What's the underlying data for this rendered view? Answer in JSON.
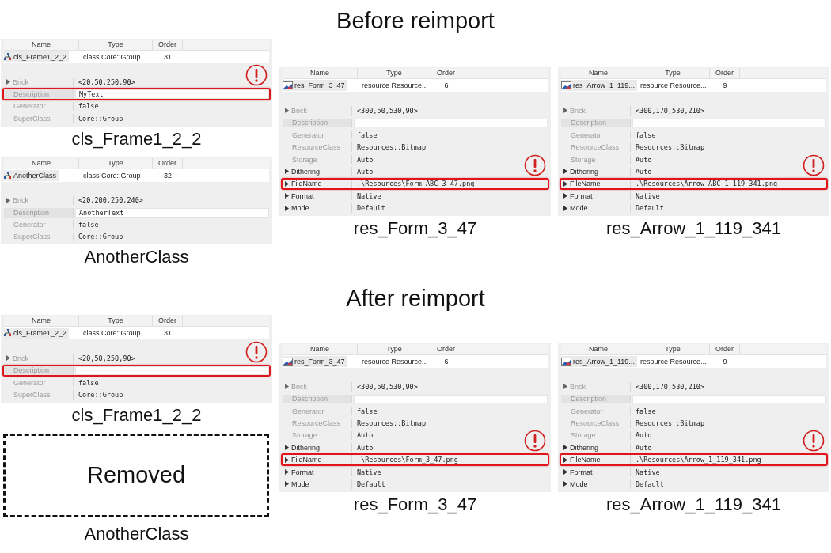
{
  "sections": [
    {
      "heading": "Before reimport",
      "columns": [
        {
          "panels": [
            {
              "kind": "inspector",
              "caption": "cls_Frame1_2_2",
              "columns": [
                "Name",
                "Type",
                "Order"
              ],
              "item": {
                "kind": "class",
                "name": "cls_Frame1_2_2",
                "type": "class Core::Group",
                "order": "31"
              },
              "properties": [
                {
                  "label": "Brick",
                  "expandable": true,
                  "dimmed": true,
                  "editable": false,
                  "highlighted": false,
                  "value": "<20,50,250,90>"
                },
                {
                  "label": "Description",
                  "expandable": false,
                  "dimmed": true,
                  "editable": true,
                  "highlighted": true,
                  "value": "MyText"
                },
                {
                  "label": "Generator",
                  "expandable": false,
                  "dimmed": true,
                  "editable": false,
                  "highlighted": false,
                  "value": "false"
                },
                {
                  "label": "SuperClass",
                  "expandable": false,
                  "dimmed": true,
                  "editable": false,
                  "highlighted": false,
                  "value": "Core::Group"
                }
              ]
            },
            {
              "kind": "inspector",
              "caption": "AnotherClass",
              "columns": [
                "Name",
                "Type",
                "Order"
              ],
              "item": {
                "kind": "class",
                "name": "AnotherClass",
                "type": "class Core::Group",
                "order": "32"
              },
              "properties": [
                {
                  "label": "Brick",
                  "expandable": true,
                  "dimmed": true,
                  "editable": false,
                  "highlighted": false,
                  "value": "<20,200,250,240>"
                },
                {
                  "label": "Description",
                  "expandable": false,
                  "dimmed": true,
                  "editable": true,
                  "highlighted": false,
                  "value": "AnotherText"
                },
                {
                  "label": "Generator",
                  "expandable": false,
                  "dimmed": true,
                  "editable": false,
                  "highlighted": false,
                  "value": "false"
                },
                {
                  "label": "SuperClass",
                  "expandable": false,
                  "dimmed": true,
                  "editable": false,
                  "highlighted": false,
                  "value": "Core::Group"
                }
              ]
            }
          ]
        },
        {
          "panels": [
            {
              "kind": "inspector",
              "caption": "res_Form_3_47",
              "columns": [
                "Name",
                "Type",
                "Order"
              ],
              "item": {
                "kind": "resource",
                "name": "res_Form_3_47",
                "type": "resource Resource...",
                "order": "6"
              },
              "properties": [
                {
                  "label": "Brick",
                  "expandable": true,
                  "dimmed": true,
                  "editable": false,
                  "highlighted": false,
                  "value": "<300,50,530,90>"
                },
                {
                  "label": "Description",
                  "expandable": false,
                  "dimmed": true,
                  "editable": true,
                  "highlighted": false
                },
                {
                  "label": "Generator",
                  "expandable": false,
                  "dimmed": true,
                  "editable": false,
                  "highlighted": false,
                  "value": "false"
                },
                {
                  "label": "ResourceClass",
                  "expandable": false,
                  "dimmed": true,
                  "editable": false,
                  "highlighted": false,
                  "value": "Resources::Bitmap"
                },
                {
                  "label": "Storage",
                  "expandable": false,
                  "dimmed": true,
                  "editable": false,
                  "highlighted": false,
                  "value": "Auto"
                },
                {
                  "label": "Dithering",
                  "expandable": true,
                  "dimmed": false,
                  "editable": false,
                  "highlighted": false,
                  "value": "Auto"
                },
                {
                  "label": "FileName",
                  "expandable": true,
                  "dimmed": false,
                  "editable": false,
                  "highlighted": true,
                  "value": ".\\Resources\\Form_ABC_3_47.png"
                },
                {
                  "label": "Format",
                  "expandable": true,
                  "dimmed": false,
                  "editable": false,
                  "highlighted": false,
                  "value": "Native"
                },
                {
                  "label": "Mode",
                  "expandable": true,
                  "dimmed": false,
                  "editable": false,
                  "highlighted": false,
                  "value": "Default"
                }
              ]
            }
          ]
        },
        {
          "panels": [
            {
              "kind": "inspector",
              "caption": "res_Arrow_1_119_341",
              "columns": [
                "Name",
                "Type",
                "Order"
              ],
              "item": {
                "kind": "resource",
                "name": "res_Arrow_1_119...",
                "type": "resource Resource...",
                "order": "9"
              },
              "properties": [
                {
                  "label": "Brick",
                  "expandable": true,
                  "dimmed": true,
                  "editable": false,
                  "highlighted": false,
                  "value": "<300,170,530,210>"
                },
                {
                  "label": "Description",
                  "expandable": false,
                  "dimmed": true,
                  "editable": true,
                  "highlighted": false
                },
                {
                  "label": "Generator",
                  "expandable": false,
                  "dimmed": true,
                  "editable": false,
                  "highlighted": false,
                  "value": "false"
                },
                {
                  "label": "ResourceClass",
                  "expandable": false,
                  "dimmed": true,
                  "editable": false,
                  "highlighted": false,
                  "value": "Resources::Bitmap"
                },
                {
                  "label": "Storage",
                  "expandable": false,
                  "dimmed": true,
                  "editable": false,
                  "highlighted": false,
                  "value": "Auto"
                },
                {
                  "label": "Dithering",
                  "expandable": true,
                  "dimmed": false,
                  "editable": false,
                  "highlighted": false,
                  "value": "Auto"
                },
                {
                  "label": "FileName",
                  "expandable": true,
                  "dimmed": false,
                  "editable": false,
                  "highlighted": true,
                  "value": ".\\Resources\\Arrow_ABC_1_119_341.png"
                },
                {
                  "label": "Format",
                  "expandable": true,
                  "dimmed": false,
                  "editable": false,
                  "highlighted": false,
                  "value": "Native"
                },
                {
                  "label": "Mode",
                  "expandable": true,
                  "dimmed": false,
                  "editable": false,
                  "highlighted": false,
                  "value": "Default"
                }
              ]
            }
          ]
        }
      ]
    },
    {
      "heading": "After reimport",
      "columns": [
        {
          "panels": [
            {
              "kind": "inspector",
              "caption": "cls_Frame1_2_2",
              "columns": [
                "Name",
                "Type",
                "Order"
              ],
              "item": {
                "kind": "class",
                "name": "cls_Frame1_2_2",
                "type": "class Core::Group",
                "order": "31"
              },
              "properties": [
                {
                  "label": "Brick",
                  "expandable": true,
                  "dimmed": true,
                  "editable": false,
                  "highlighted": false,
                  "value": "<20,50,250,90>"
                },
                {
                  "label": "Description",
                  "expandable": false,
                  "dimmed": true,
                  "editable": true,
                  "highlighted": true
                },
                {
                  "label": "Generator",
                  "expandable": false,
                  "dimmed": true,
                  "editable": false,
                  "highlighted": false,
                  "value": "false"
                },
                {
                  "label": "SuperClass",
                  "expandable": false,
                  "dimmed": true,
                  "editable": false,
                  "highlighted": false,
                  "value": "Core::Group"
                }
              ]
            },
            {
              "kind": "removed",
              "label": "Removed",
              "caption": "AnotherClass"
            }
          ]
        },
        {
          "panels": [
            {
              "kind": "inspector",
              "caption": "res_Form_3_47",
              "columns": [
                "Name",
                "Type",
                "Order"
              ],
              "item": {
                "kind": "resource",
                "name": "res_Form_3_47",
                "type": "resource Resource...",
                "order": "6"
              },
              "properties": [
                {
                  "label": "Brick",
                  "expandable": true,
                  "dimmed": true,
                  "editable": false,
                  "highlighted": false,
                  "value": "<300,50,530,90>"
                },
                {
                  "label": "Description",
                  "expandable": false,
                  "dimmed": true,
                  "editable": true,
                  "highlighted": false
                },
                {
                  "label": "Generator",
                  "expandable": false,
                  "dimmed": true,
                  "editable": false,
                  "highlighted": false,
                  "value": "false"
                },
                {
                  "label": "ResourceClass",
                  "expandable": false,
                  "dimmed": true,
                  "editable": false,
                  "highlighted": false,
                  "value": "Resources::Bitmap"
                },
                {
                  "label": "Storage",
                  "expandable": false,
                  "dimmed": true,
                  "editable": false,
                  "highlighted": false,
                  "value": "Auto"
                },
                {
                  "label": "Dithering",
                  "expandable": true,
                  "dimmed": false,
                  "editable": false,
                  "highlighted": false,
                  "value": "Auto"
                },
                {
                  "label": "FileName",
                  "expandable": true,
                  "dimmed": false,
                  "editable": false,
                  "highlighted": true,
                  "value": ".\\Resources\\Form_3_47.png"
                },
                {
                  "label": "Format",
                  "expandable": true,
                  "dimmed": false,
                  "editable": false,
                  "highlighted": false,
                  "value": "Native"
                },
                {
                  "label": "Mode",
                  "expandable": true,
                  "dimmed": false,
                  "editable": false,
                  "highlighted": false,
                  "value": "Default"
                }
              ]
            }
          ]
        },
        {
          "panels": [
            {
              "kind": "inspector",
              "caption": "res_Arrow_1_119_341",
              "columns": [
                "Name",
                "Type",
                "Order"
              ],
              "item": {
                "kind": "resource",
                "name": "res_Arrow_1_119...",
                "type": "resource Resource...",
                "order": "9"
              },
              "properties": [
                {
                  "label": "Brick",
                  "expandable": true,
                  "dimmed": true,
                  "editable": false,
                  "highlighted": false,
                  "value": "<300,170,530,210>"
                },
                {
                  "label": "Description",
                  "expandable": false,
                  "dimmed": true,
                  "editable": true,
                  "highlighted": false
                },
                {
                  "label": "Generator",
                  "expandable": false,
                  "dimmed": true,
                  "editable": false,
                  "highlighted": false,
                  "value": "false"
                },
                {
                  "label": "ResourceClass",
                  "expandable": false,
                  "dimmed": true,
                  "editable": false,
                  "highlighted": false,
                  "value": "Resources::Bitmap"
                },
                {
                  "label": "Storage",
                  "expandable": false,
                  "dimmed": true,
                  "editable": false,
                  "highlighted": false,
                  "value": "Auto"
                },
                {
                  "label": "Dithering",
                  "expandable": true,
                  "dimmed": false,
                  "editable": false,
                  "highlighted": false,
                  "value": "Auto"
                },
                {
                  "label": "FileName",
                  "expandable": true,
                  "dimmed": false,
                  "editable": false,
                  "highlighted": true,
                  "value": ".\\Resources\\Arrow_1_119_341.png"
                },
                {
                  "label": "Format",
                  "expandable": true,
                  "dimmed": false,
                  "editable": false,
                  "highlighted": false,
                  "value": "Native"
                },
                {
                  "label": "Mode",
                  "expandable": true,
                  "dimmed": false,
                  "editable": false,
                  "highlighted": false,
                  "value": "Default"
                }
              ]
            }
          ]
        }
      ]
    }
  ]
}
